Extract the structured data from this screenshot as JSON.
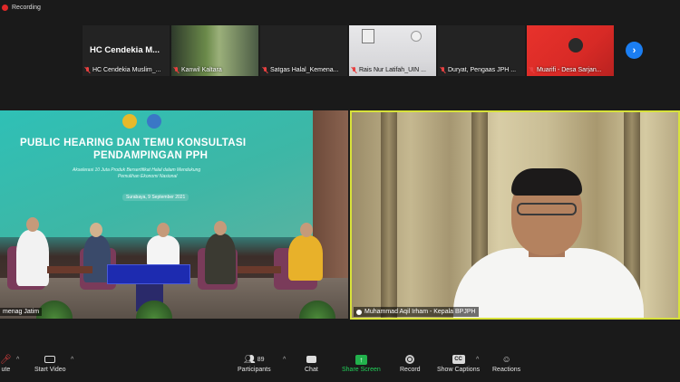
{
  "recording": {
    "label": "Recording"
  },
  "thumbnails": [
    {
      "display_name": "HC Cendekia M...",
      "label": "HC Cendekia Muslim_...",
      "scene": "text"
    },
    {
      "label": "Kanwil Kaltara",
      "scene": "kaltara"
    },
    {
      "label": "Satgas Halal_Kemena...",
      "scene": "blank"
    },
    {
      "label": "Rais Nur Latifah_UIN ...",
      "scene": "rais"
    },
    {
      "label": "Duryat, Pengaas JPH ...",
      "scene": "blank"
    },
    {
      "label": "Muarifi - Desa Sarjan...",
      "scene": "muarifi"
    }
  ],
  "banner": {
    "title_line1": "PUBLIC HEARING DAN TEMU KONSULTASI",
    "title_line2": "PENDAMPINGAN PPH",
    "subtitle_line1": "Akselerasi 10 Juta Produk Bersertifikat Halal dalam Mendukung",
    "subtitle_line2": "Pemulihan Ekonomi Nasional",
    "date": "Surabaya, 9 September 2021"
  },
  "left_video": {
    "name": "menag Jatim"
  },
  "right_video": {
    "name": "Muhammad Aqil Irham - Kepala BPJPH"
  },
  "toolbar": {
    "mute": "ute",
    "start_video": "Start Video",
    "participants": "Participants",
    "participants_count": "89",
    "chat": "Chat",
    "share_screen": "Share Screen",
    "record": "Record",
    "show_captions": "Show Captions",
    "reactions": "Reactions"
  },
  "colors": {
    "active_speaker_border": "#d8e23a",
    "share_green": "#22b14c",
    "next_button_blue": "#1b7ef2",
    "recording_red": "#e02828"
  }
}
